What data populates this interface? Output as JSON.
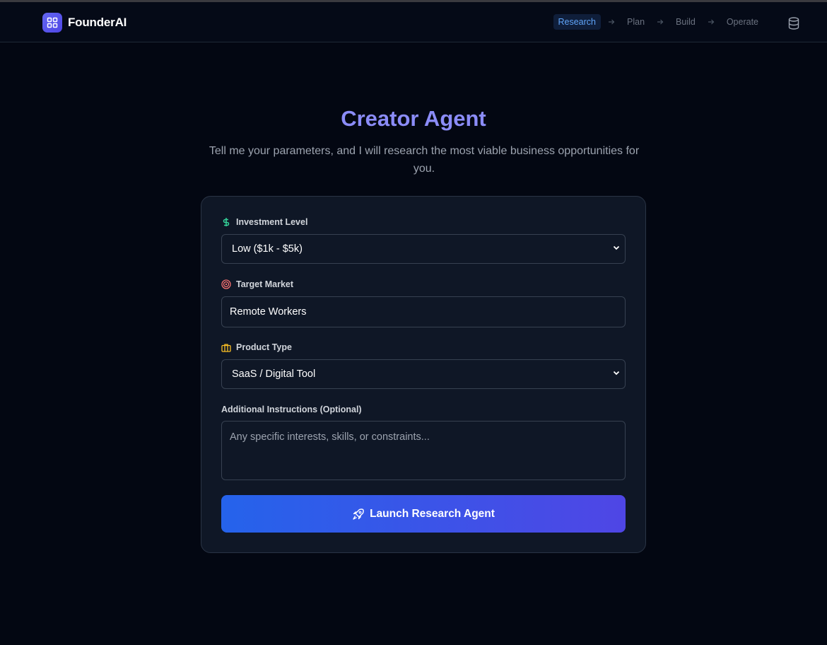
{
  "app": {
    "name": "FounderAI",
    "logo_icon": "grid-icon"
  },
  "nav": {
    "steps": [
      {
        "label": "Research",
        "active": true
      },
      {
        "label": "Plan",
        "active": false
      },
      {
        "label": "Build",
        "active": false
      },
      {
        "label": "Operate",
        "active": false
      }
    ],
    "database_icon": "database-icon"
  },
  "hero": {
    "title": "Creator Agent",
    "subtitle": "Tell me your parameters, and I will research the most viable business opportunities for you."
  },
  "form": {
    "investment": {
      "label": "Investment Level",
      "icon": "dollar-icon",
      "value": "Low ($1k - $5k)"
    },
    "target_market": {
      "label": "Target Market",
      "icon": "target-icon",
      "value": "Remote Workers"
    },
    "product_type": {
      "label": "Product Type",
      "icon": "briefcase-icon",
      "value": "SaaS / Digital Tool"
    },
    "instructions": {
      "label": "Additional Instructions (Optional)",
      "placeholder": "Any specific interests, skills, or constraints..."
    },
    "submit": {
      "label": "Launch Research Agent",
      "icon": "rocket-icon"
    }
  },
  "colors": {
    "background": "#030712",
    "card": "#0f1726",
    "accent": "#8b8cf8",
    "button_start": "#2563eb",
    "button_end": "#4f46e5",
    "active_step": "#60a5fa"
  }
}
